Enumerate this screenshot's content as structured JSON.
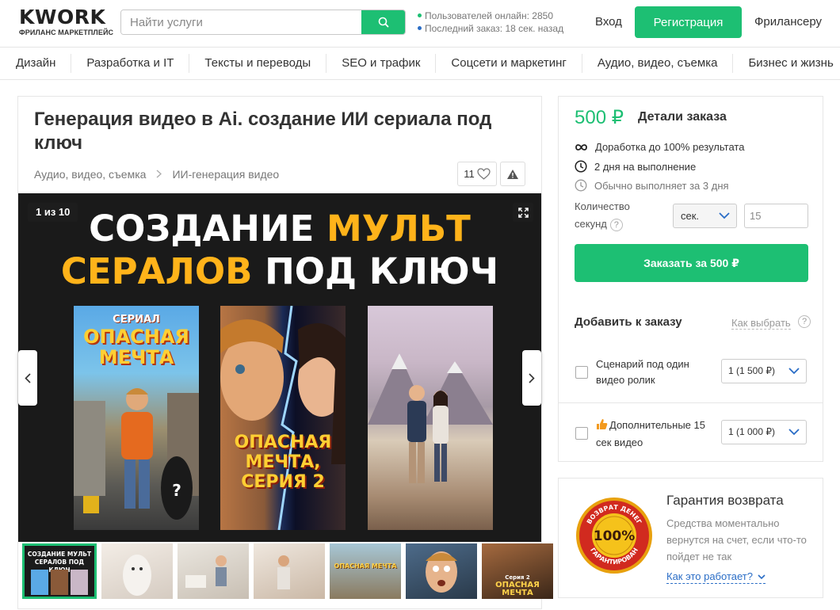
{
  "header": {
    "logo_main": "KWORK",
    "logo_sub": "ФРИЛАНС МАРКЕТПЛЕЙС",
    "search_placeholder": "Найти услуги",
    "online_users": "Пользователей онлайн: 2850",
    "last_order": "Последний заказ: 18 сек. назад",
    "login": "Вход",
    "register": "Регистрация",
    "freelancer": "Фрилансеру"
  },
  "categories": [
    "Дизайн",
    "Разработка и IT",
    "Тексты и переводы",
    "SEO и трафик",
    "Соцсети и маркетинг",
    "Аудио, видео, съемка",
    "Бизнес и жизнь"
  ],
  "kwork": {
    "title": "Генерация видео в Ai. создание ИИ сериала под ключ",
    "breadcrumbs": [
      "Аудио, видео, съемка",
      "ИИ-генерация видео"
    ],
    "favorites_count": "11",
    "gallery": {
      "counter": "1 из 10",
      "headline_white_1": "СОЗДАНИЕ ",
      "headline_yellow_1": "МУЛЬТ",
      "headline_yellow_2": "СЕРАЛОВ",
      "headline_white_2": " ПОД КЛЮЧ",
      "poster1_small": "СЕРИАЛ",
      "poster1_title_1": "ОПАСНАЯ",
      "poster1_title_2": "МЕЧТА",
      "poster2_title_1": "ОПАСНАЯ",
      "poster2_title_2": "МЕЧТА,",
      "poster2_title_3": "СЕРИЯ 2"
    },
    "thumbs": [
      {
        "line1": "СОЗДАНИЕ МУЛЬТ",
        "line2": "СЕРАЛОВ ПОД КЛЮЧ"
      },
      {
        "caption": ""
      },
      {
        "caption": ""
      },
      {
        "caption": ""
      },
      {
        "caption": "ОПАСНАЯ МЕЧТА"
      },
      {
        "caption": ""
      },
      {
        "line1": "Серия 2",
        "line2": "ОПАСНАЯ",
        "line3": "МЕЧТА"
      }
    ]
  },
  "order": {
    "price": "500 ₽",
    "details_label": "Детали заказа",
    "revision": "Доработка до 100% результата",
    "duration": "2 дня на выполнение",
    "usually": "Обычно выполняет за 3 дня",
    "qty_label_1": "Количество",
    "qty_label_2": "секунд",
    "unit": "сек.",
    "qty_value": "15",
    "buy_button": "Заказать за 500 ₽",
    "add_title": "Добавить к заказу",
    "how_to_choose": "Как выбрать",
    "extras": [
      {
        "label": "Сценарий под один видео ролик",
        "select": "1 (1 500 ₽)"
      },
      {
        "label": "Дополнительные 15 сек видео",
        "select": "1 (1 000 ₽)"
      }
    ]
  },
  "guarantee": {
    "title": "Гарантия возврата",
    "text": "Средства моментально вернутся на счет, если что-то пойдет не так",
    "link": "Как это работает?",
    "seal_top": "ВОЗВРАТ ДЕНЕГ",
    "seal_center": "100%",
    "seal_bottom": "ГАРАНТИРОВАН"
  },
  "colors": {
    "accent": "#1dbf73",
    "link": "#2a6dc6",
    "headline_yellow": "#ffb31a"
  }
}
